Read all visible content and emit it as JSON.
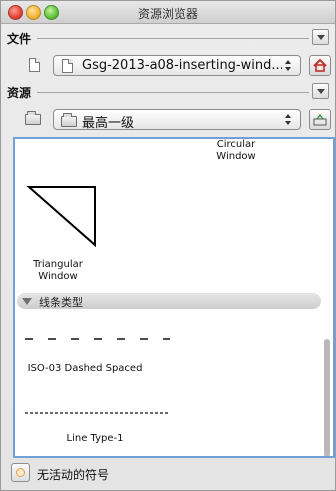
{
  "window": {
    "title": "资源浏览器"
  },
  "file_section": {
    "label": "文件",
    "selected_file": "Gsg-2013-a08-inserting-wind..."
  },
  "resource_section": {
    "label": "资源",
    "selected_level": "最高一级"
  },
  "content": {
    "items_top": [
      {
        "name": "Circular\nWindow"
      },
      {
        "name": "Triangular\nWindow"
      }
    ],
    "group": {
      "label": "线条类型"
    },
    "line_types": [
      {
        "name": "ISO-03 Dashed Spaced"
      },
      {
        "name": "Line Type-1"
      }
    ]
  },
  "status": {
    "text": "无活动的符号"
  },
  "colors": {
    "panel_border": "#6fa0d8",
    "home_icon": "#c0302a"
  },
  "icons": [
    "file-icon",
    "folder-icon",
    "home-icon",
    "tray-icon",
    "symbol-icon"
  ]
}
